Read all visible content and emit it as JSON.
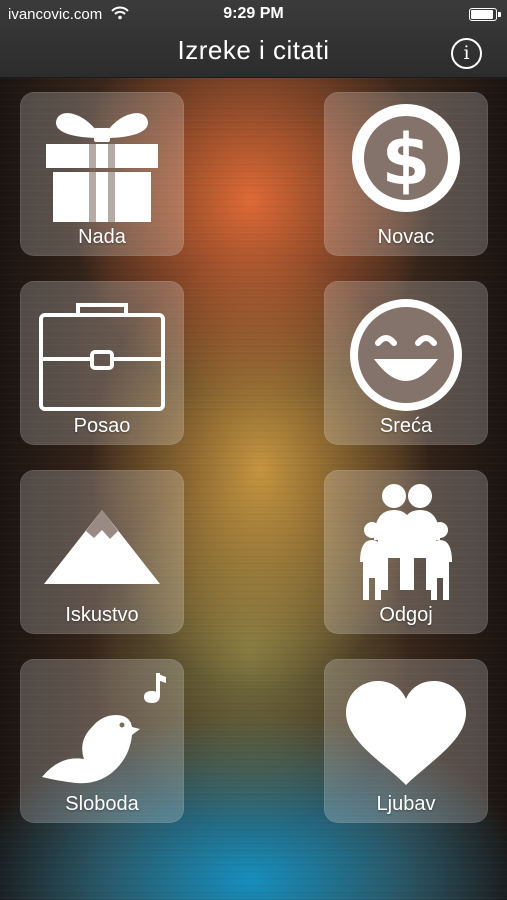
{
  "status_bar": {
    "carrier": "ivancovic.com",
    "wifi_icon": "wifi-icon",
    "time": "9:29 PM",
    "battery_level": 0.95
  },
  "nav": {
    "title": "Izreke i citati",
    "info_label": "i"
  },
  "tiles": [
    {
      "label": "Nada",
      "icon": "gift-icon"
    },
    {
      "label": "Novac",
      "icon": "dollar-coin-icon"
    },
    {
      "label": "Posao",
      "icon": "briefcase-icon"
    },
    {
      "label": "Sreća",
      "icon": "smiley-icon"
    },
    {
      "label": "Iskustvo",
      "icon": "mountain-icon"
    },
    {
      "label": "Odgoj",
      "icon": "family-icon"
    },
    {
      "label": "Sloboda",
      "icon": "singing-bird-icon"
    },
    {
      "label": "Ljubav",
      "icon": "heart-icon"
    }
  ],
  "colors": {
    "tile_background": "rgba(255,255,255,0.22)",
    "topbar": "#333333",
    "glow_orange": "#eb6e37",
    "glow_blue": "#1496c8"
  }
}
